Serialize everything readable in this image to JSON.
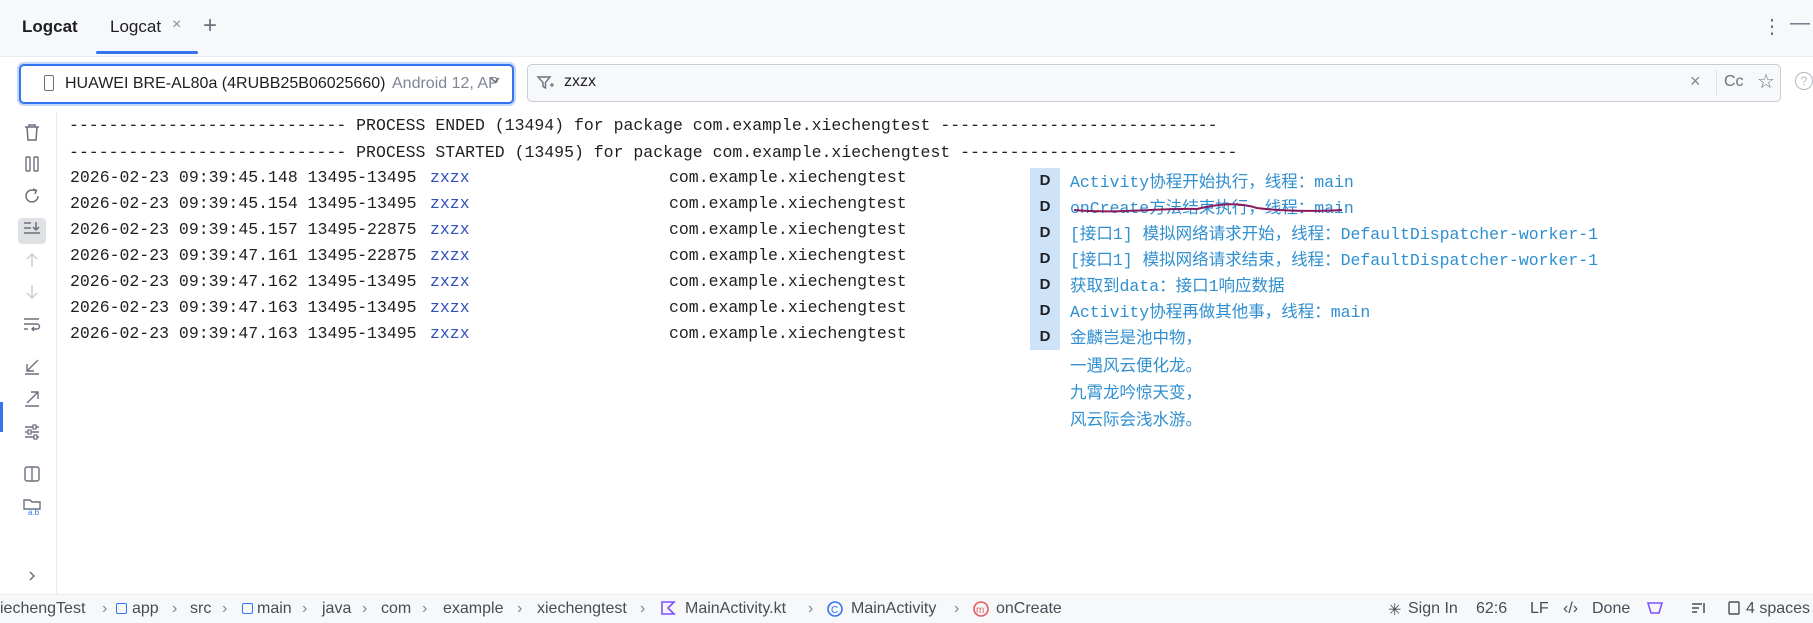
{
  "tabbar": {
    "tool_title": "Logcat",
    "tab_label": "Logcat",
    "close_glyph": "×",
    "add_glyph": "+",
    "more_glyph": "⋮",
    "minimize_glyph": "—"
  },
  "device": {
    "name": "HUAWEI BRE-AL80a (4RUBB25B06025660)",
    "os": "Android 12, AP",
    "chevron": "⌄"
  },
  "filter": {
    "query": "zxzx",
    "clear_glyph": "×",
    "case_label": "Cc",
    "star_glyph": "☆",
    "help_glyph": "?"
  },
  "log": {
    "process_ended": "---------------------------- PROCESS ENDED (13494) for package com.example.xiechengtest ----------------------------",
    "process_started": "---------------------------- PROCESS STARTED (13495) for package com.example.xiechengtest ----------------------------",
    "entries": [
      {
        "ts": "2026-02-23 09:39:45.148 13495-13495",
        "tag": "zxzx",
        "pkg": "com.example.xiechengtest",
        "level": "D",
        "msg": "Activity协程开始执行，线程：main"
      },
      {
        "ts": "2026-02-23 09:39:45.154 13495-13495",
        "tag": "zxzx",
        "pkg": "com.example.xiechengtest",
        "level": "D",
        "msg": "onCreate方法结束执行，线程：main"
      },
      {
        "ts": "2026-02-23 09:39:45.157 13495-22875",
        "tag": "zxzx",
        "pkg": "com.example.xiechengtest",
        "level": "D",
        "msg": "[接口1] 模拟网络请求开始，线程：DefaultDispatcher-worker-1"
      },
      {
        "ts": "2026-02-23 09:39:47.161 13495-22875",
        "tag": "zxzx",
        "pkg": "com.example.xiechengtest",
        "level": "D",
        "msg": "[接口1] 模拟网络请求结束，线程：DefaultDispatcher-worker-1"
      },
      {
        "ts": "2026-02-23 09:39:47.162 13495-13495",
        "tag": "zxzx",
        "pkg": "com.example.xiechengtest",
        "level": "D",
        "msg": "获取到data：接口1响应数据"
      },
      {
        "ts": "2026-02-23 09:39:47.163 13495-13495",
        "tag": "zxzx",
        "pkg": "com.example.xiechengtest",
        "level": "D",
        "msg": "Activity协程再做其他事，线程：main"
      },
      {
        "ts": "2026-02-23 09:39:47.163 13495-13495",
        "tag": "zxzx",
        "pkg": "com.example.xiechengtest",
        "level": "D",
        "msg": "金麟岂是池中物，"
      }
    ],
    "continuation": [
      "一遇风云便化龙。",
      "九霄龙吟惊天变，",
      "风云际会浅水游。"
    ]
  },
  "statusbar": {
    "breadcrumbs": [
      "iechengTest",
      "app",
      "src",
      "main",
      "java",
      "com",
      "example",
      "xiechengtest",
      "MainActivity.kt",
      "MainActivity",
      "onCreate"
    ],
    "sign_in": "Sign In",
    "position": "62:6",
    "line_ending": "LF",
    "done": "Done",
    "indent": "4 spaces"
  },
  "colors": {
    "accent": "#3574f0",
    "tag": "#2f4fbf",
    "message": "#2f8fd0",
    "level_bg": "#cfe3f8",
    "annotation": "#8b1a5c"
  },
  "icons": [
    "trash-icon",
    "pause-icon",
    "restart-icon",
    "scroll-to-end-icon",
    "up-arrow-icon",
    "down-arrow-icon",
    "soft-wrap-icon",
    "collapse-icon",
    "expand-icon",
    "settings-icon",
    "split-icon",
    "folder-ab-icon",
    "more-chevron-icon"
  ]
}
